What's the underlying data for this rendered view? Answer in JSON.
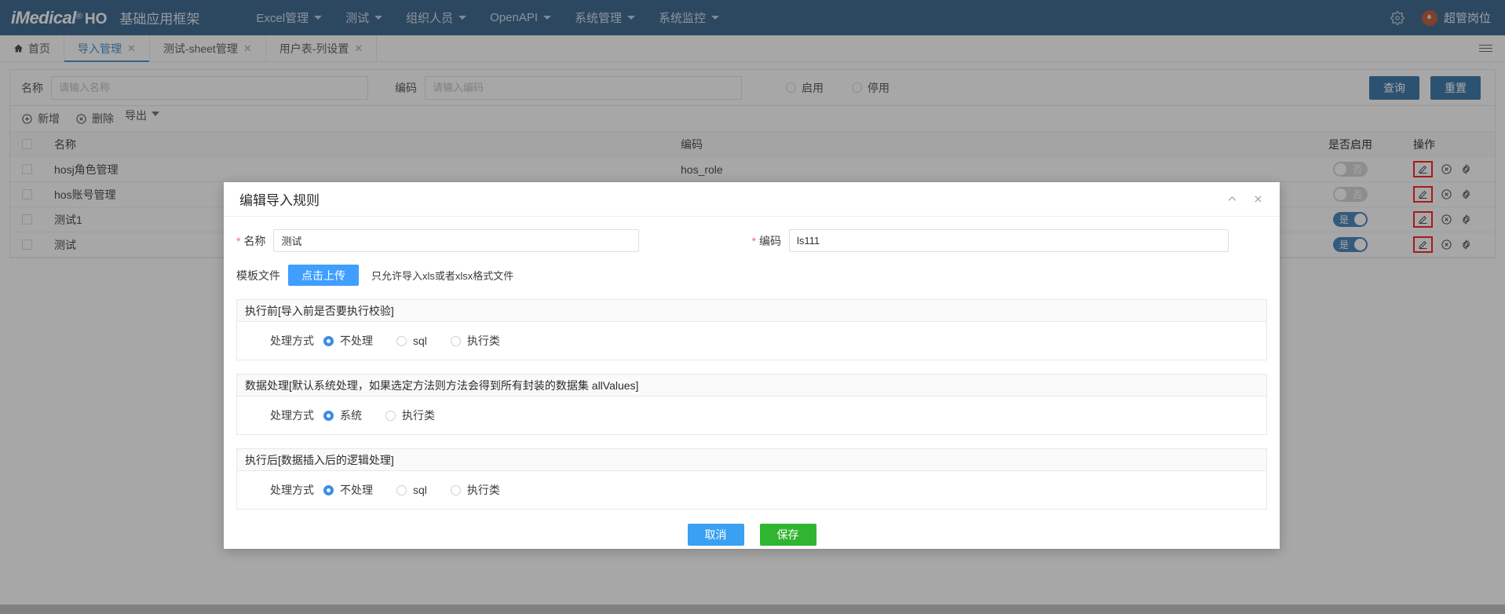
{
  "header": {
    "brand_main": "iMedical",
    "brand_reg": "®",
    "brand_ho": "HO",
    "brand_sub": "基础应用框架",
    "nav": [
      {
        "label": "Excel管理",
        "has_caret": true
      },
      {
        "label": "测试",
        "has_caret": true
      },
      {
        "label": "组织人员",
        "has_caret": true
      },
      {
        "label": "OpenAPI",
        "has_caret": true
      },
      {
        "label": "系统管理",
        "has_caret": true
      },
      {
        "label": "系统监控",
        "has_caret": true
      }
    ],
    "settings_icon": "gear-icon",
    "user_name": "超管岗位",
    "avatar_icon": "flame-icon"
  },
  "tabs": [
    {
      "label": "首页",
      "closable": false,
      "active": false,
      "icon": "home-icon"
    },
    {
      "label": "导入管理",
      "closable": true,
      "active": true
    },
    {
      "label": "测试-sheet管理",
      "closable": true,
      "active": false
    },
    {
      "label": "用户表-列设置",
      "closable": true,
      "active": false
    }
  ],
  "tab_close_glyph": "✕",
  "filter": {
    "name_label": "名称",
    "name_value": "",
    "name_placeholder": "请输入名称",
    "code_label": "编码",
    "code_value": "",
    "code_placeholder": "请输入编码",
    "radios": [
      {
        "label": "启用",
        "checked": false
      },
      {
        "label": "停用",
        "checked": false
      }
    ],
    "search_button": "查询",
    "reset_button": "重置"
  },
  "toolbar": {
    "add_label": "新增",
    "delete_label": "删除",
    "export_label": "导出"
  },
  "table": {
    "columns": [
      "名称",
      "编码",
      "是否启用",
      "操作"
    ],
    "rows": [
      {
        "name": "hosj角色管理",
        "code": "hos_role",
        "enabled": false,
        "enabled_text": "否"
      },
      {
        "name": "hos账号管理",
        "code": "",
        "enabled": false,
        "enabled_text": "否"
      },
      {
        "name": "测试1",
        "code": "",
        "enabled": true,
        "enabled_text": "是"
      },
      {
        "name": "测试",
        "code": "",
        "enabled": true,
        "enabled_text": "是"
      }
    ],
    "action_icons": [
      "edit-pencil-icon",
      "delete-circle-icon",
      "settings-gear-icon"
    ]
  },
  "modal": {
    "title": "编辑导入规则",
    "collapse_icon": "chevron-up-icon",
    "close_icon": "close-icon",
    "name_label": "名称",
    "name_value": "测试",
    "code_label": "编码",
    "code_value": "ls111",
    "template_label": "模板文件",
    "upload_button": "点击上传",
    "upload_hint": "只允许导入xls或者xlsx格式文件",
    "sections": [
      {
        "title": "执行前[导入前是否要执行校验]",
        "field_label": "处理方式",
        "options": [
          {
            "label": "不处理",
            "checked": true
          },
          {
            "label": "sql",
            "checked": false
          },
          {
            "label": "执行类",
            "checked": false
          }
        ]
      },
      {
        "title": "数据处理[默认系统处理，如果选定方法则方法会得到所有封装的数据集 allValues]",
        "field_label": "处理方式",
        "options": [
          {
            "label": "系统",
            "checked": true
          },
          {
            "label": "执行类",
            "checked": false
          }
        ]
      },
      {
        "title": "执行后[数据插入后的逻辑处理]",
        "field_label": "处理方式",
        "options": [
          {
            "label": "不处理",
            "checked": true
          },
          {
            "label": "sql",
            "checked": false
          },
          {
            "label": "执行类",
            "checked": false
          }
        ]
      }
    ],
    "cancel_button": "取消",
    "save_button": "保存"
  },
  "colors": {
    "header_bg": "#20507f",
    "accent": "#2d82c7",
    "primary_button": "#20649f",
    "upload_button": "#409eff",
    "cancel_button": "#3aa0f3",
    "save_button": "#30b531",
    "switch_on": "#2f74b5",
    "highlight_box": "#ff0000"
  }
}
